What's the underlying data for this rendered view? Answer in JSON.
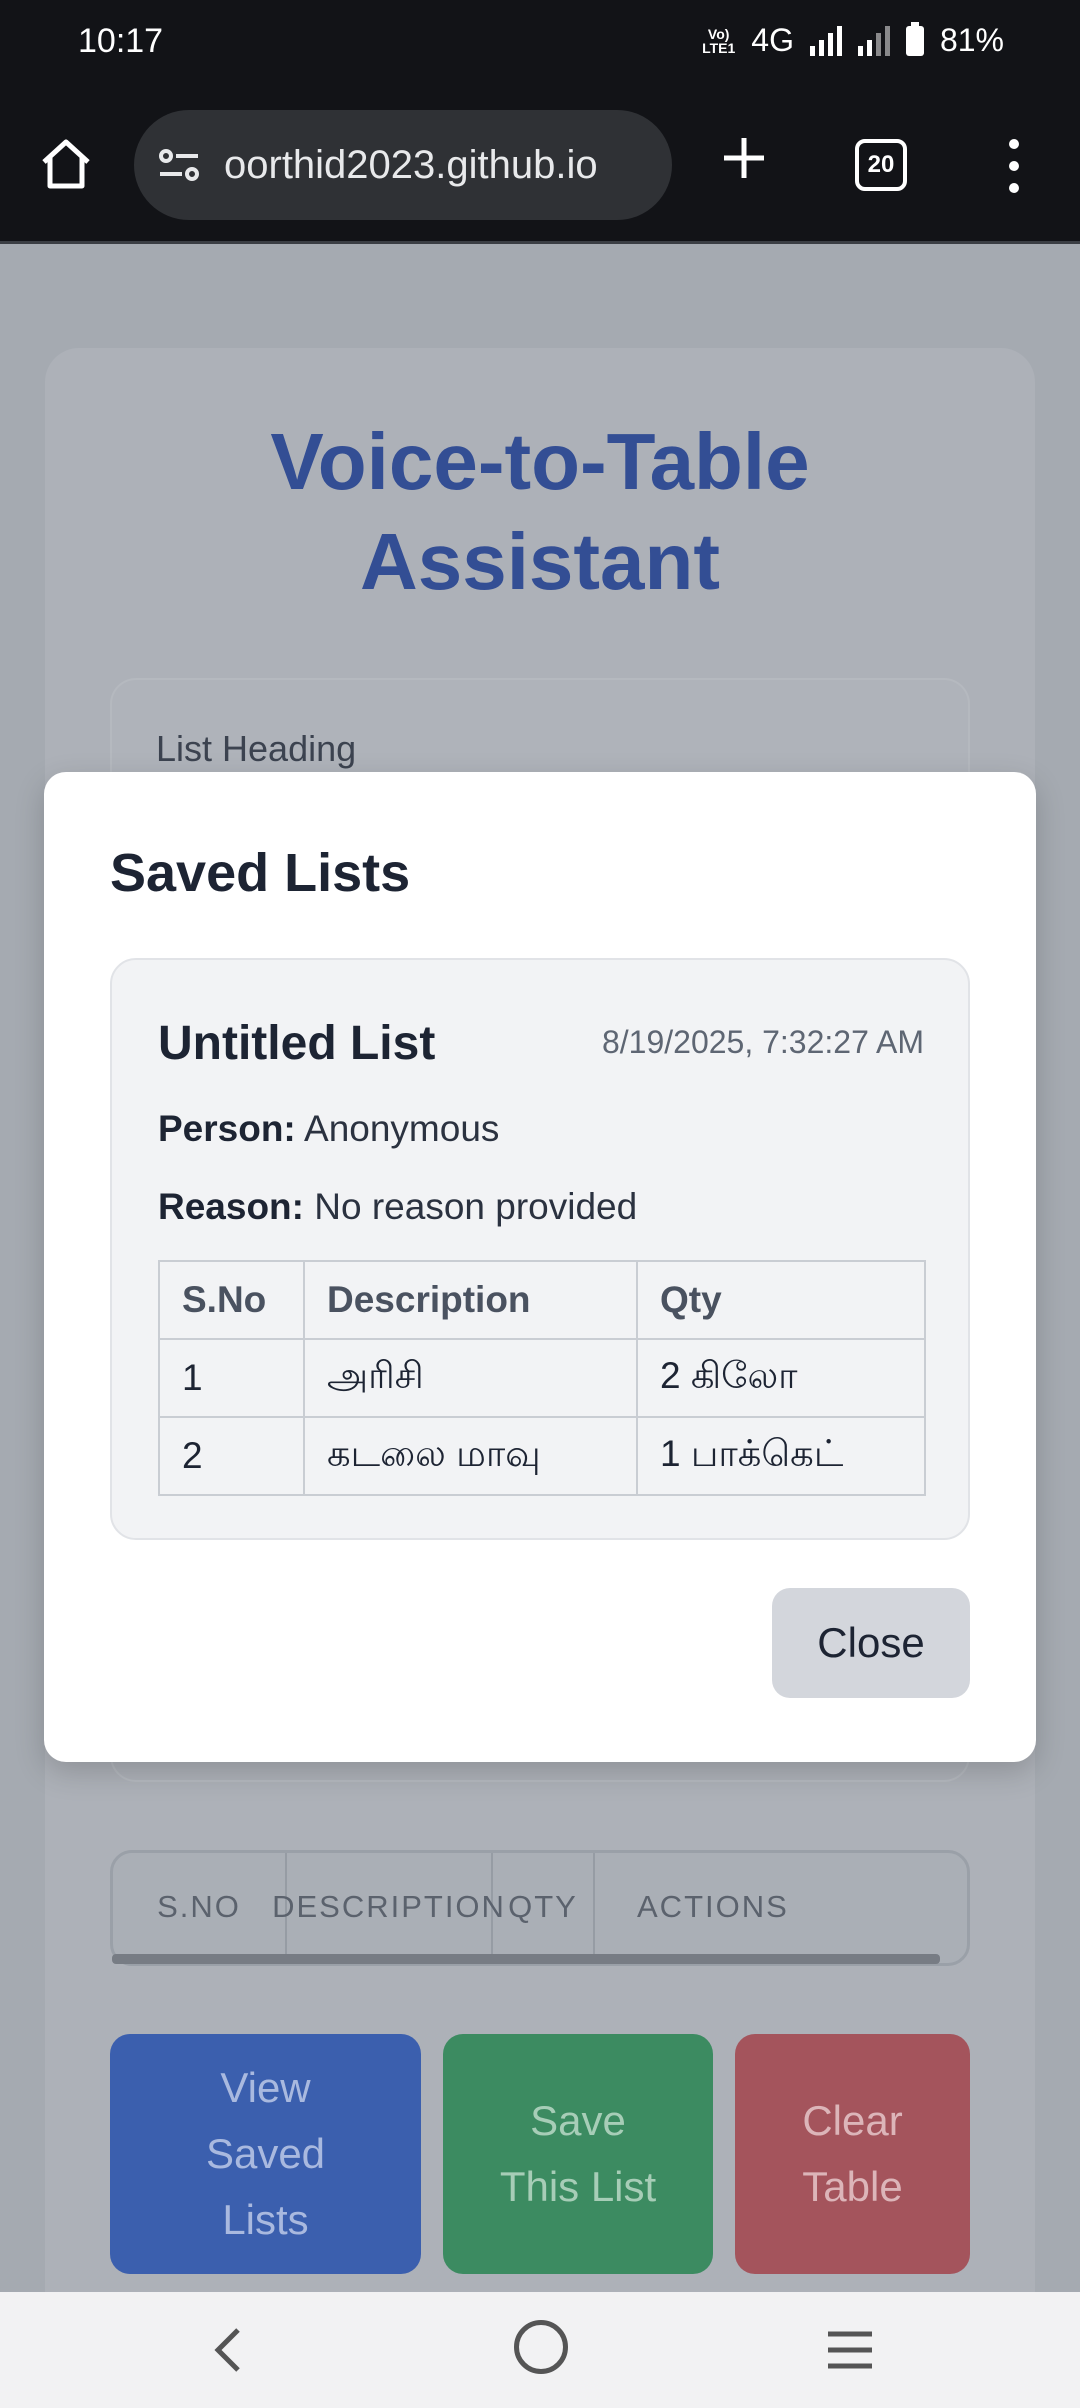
{
  "status_bar": {
    "time": "10:17",
    "volte": "VoLTE1",
    "network": "4G",
    "battery": "81%"
  },
  "browser": {
    "url": "oorthid2023.github.io",
    "tab_count": "20",
    "icons": [
      "home-icon",
      "site-settings-icon",
      "new-tab-plus-icon",
      "tab-switcher-icon",
      "more-vert-icon"
    ]
  },
  "page": {
    "title_line1": "Voice-to-Table",
    "title_line2": "Assistant",
    "list_heading_label": "List Heading",
    "table_columns": [
      "S.NO",
      "DESCRIPTION",
      "QTY",
      "ACTIONS"
    ],
    "buttons": {
      "view_saved": [
        "View",
        "Saved",
        "Lists"
      ],
      "save_list": [
        "Save",
        "This List"
      ],
      "clear_table": [
        "Clear",
        "Table"
      ]
    },
    "colors": {
      "title": "#334e94",
      "view_button": "#3b5fae",
      "save_button": "#3c8b61",
      "clear_button": "#a4545c"
    }
  },
  "modal": {
    "title": "Saved Lists",
    "list": {
      "name": "Untitled List",
      "date": "8/19/2025, 7:32:27 AM",
      "person_label": "Person:",
      "person_value": "Anonymous",
      "reason_label": "Reason:",
      "reason_value": "No reason provided",
      "columns": [
        "S.No",
        "Description",
        "Qty"
      ],
      "rows": [
        [
          "1",
          "அரிசி",
          "2 கிலோ"
        ],
        [
          "2",
          "கடலை மாவு",
          "1 பாக்கெட்"
        ]
      ]
    },
    "close_label": "Close"
  },
  "navbar": {
    "icons": [
      "back-icon",
      "home-circle-icon",
      "recent-apps-icon"
    ]
  }
}
